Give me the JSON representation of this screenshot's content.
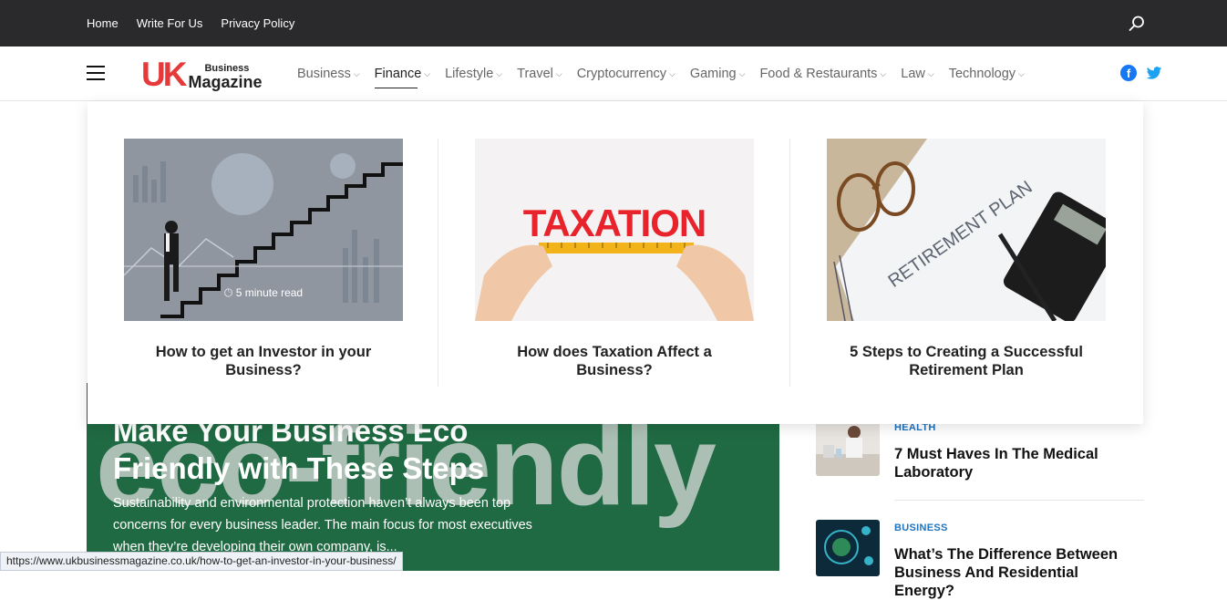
{
  "topbar": {
    "links": [
      "Home",
      "Write For Us",
      "Privacy Policy"
    ]
  },
  "logo": {
    "mark": "UK",
    "small": "Business",
    "big": "Magazine"
  },
  "nav": [
    {
      "label": "Business"
    },
    {
      "label": "Finance"
    },
    {
      "label": "Lifestyle"
    },
    {
      "label": "Travel"
    },
    {
      "label": "Cryptocurrency"
    },
    {
      "label": "Gaming"
    },
    {
      "label": "Food & Restaurants"
    },
    {
      "label": "Law"
    },
    {
      "label": "Technology"
    }
  ],
  "social": {
    "facebook_glyph": "f"
  },
  "mega_menu": {
    "cards": [
      {
        "title": "How to get an Investor in your Business?",
        "read_time": "5 minute read"
      },
      {
        "title": "How does Taxation Affect a Business?",
        "image_text": "TAXATION"
      },
      {
        "title": "5 Steps to Creating a Successful Retirement Plan",
        "image_text": "RETIREMENT PLAN"
      }
    ]
  },
  "hero": {
    "title": "Make Your Business Eco Friendly with These Steps",
    "bg_word": "eco-friendly",
    "excerpt": "Sustainability and environmental protection haven’t always been top concerns for every business leader. The main focus for most executives when they’re developing their own company, is..."
  },
  "sidebar": [
    {
      "category": "HEALTH",
      "title": "7 Must Haves In The Medical Laboratory"
    },
    {
      "category": "BUSINESS",
      "title": "What’s The Difference Between Business And Residential Energy?"
    }
  ],
  "status_url": "https://www.ukbusinessmagazine.co.uk/how-to-get-an-investor-in-your-business/",
  "colors": {
    "accent": "#e63a3a",
    "link": "#1e73be",
    "topbar": "#2a2a2c",
    "hero": "#1f6a42"
  },
  "icons": [
    "search-icon",
    "menu-icon",
    "facebook-icon",
    "twitter-icon",
    "clock-icon",
    "chevron-down-icon"
  ]
}
